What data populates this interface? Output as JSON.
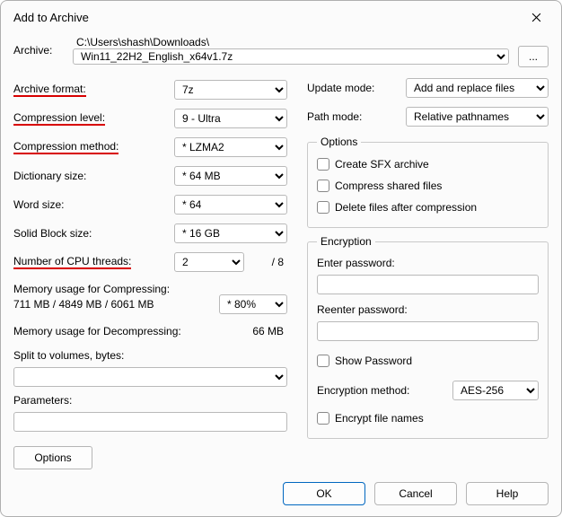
{
  "window": {
    "title": "Add to Archive"
  },
  "archive": {
    "label": "Archive:",
    "path": "C:\\Users\\shash\\Downloads\\",
    "filename": "Win11_22H2_English_x64v1.7z",
    "browse": "..."
  },
  "left": {
    "format_label": "Archive format:",
    "format_value": "7z",
    "level_label": "Compression level:",
    "level_value": "9 - Ultra",
    "method_label": "Compression method:",
    "method_value": "* LZMA2",
    "dict_label": "Dictionary size:",
    "dict_value": "* 64 MB",
    "word_label": "Word size:",
    "word_value": "* 64",
    "block_label": "Solid Block size:",
    "block_value": "* 16 GB",
    "threads_label": "Number of CPU threads:",
    "threads_value": "2",
    "threads_total": "/ 8",
    "mem_comp_label": "Memory usage for Compressing:",
    "mem_comp_value": "711 MB / 4849 MB / 6061 MB",
    "mem_pct": "* 80%",
    "mem_decomp_label": "Memory usage for Decompressing:",
    "mem_decomp_value": "66 MB",
    "split_label": "Split to volumes, bytes:",
    "params_label": "Parameters:",
    "options_btn": "Options"
  },
  "right": {
    "update_label": "Update mode:",
    "update_value": "Add and replace files",
    "path_label": "Path mode:",
    "path_value": "Relative pathnames",
    "options_legend": "Options",
    "sfx": "Create SFX archive",
    "shared": "Compress shared files",
    "delete_after": "Delete files after compression",
    "enc_legend": "Encryption",
    "enter_pw": "Enter password:",
    "reenter_pw": "Reenter password:",
    "show_pw": "Show Password",
    "enc_method_label": "Encryption method:",
    "enc_method_value": "AES-256",
    "encrypt_names": "Encrypt file names"
  },
  "footer": {
    "ok": "OK",
    "cancel": "Cancel",
    "help": "Help"
  }
}
